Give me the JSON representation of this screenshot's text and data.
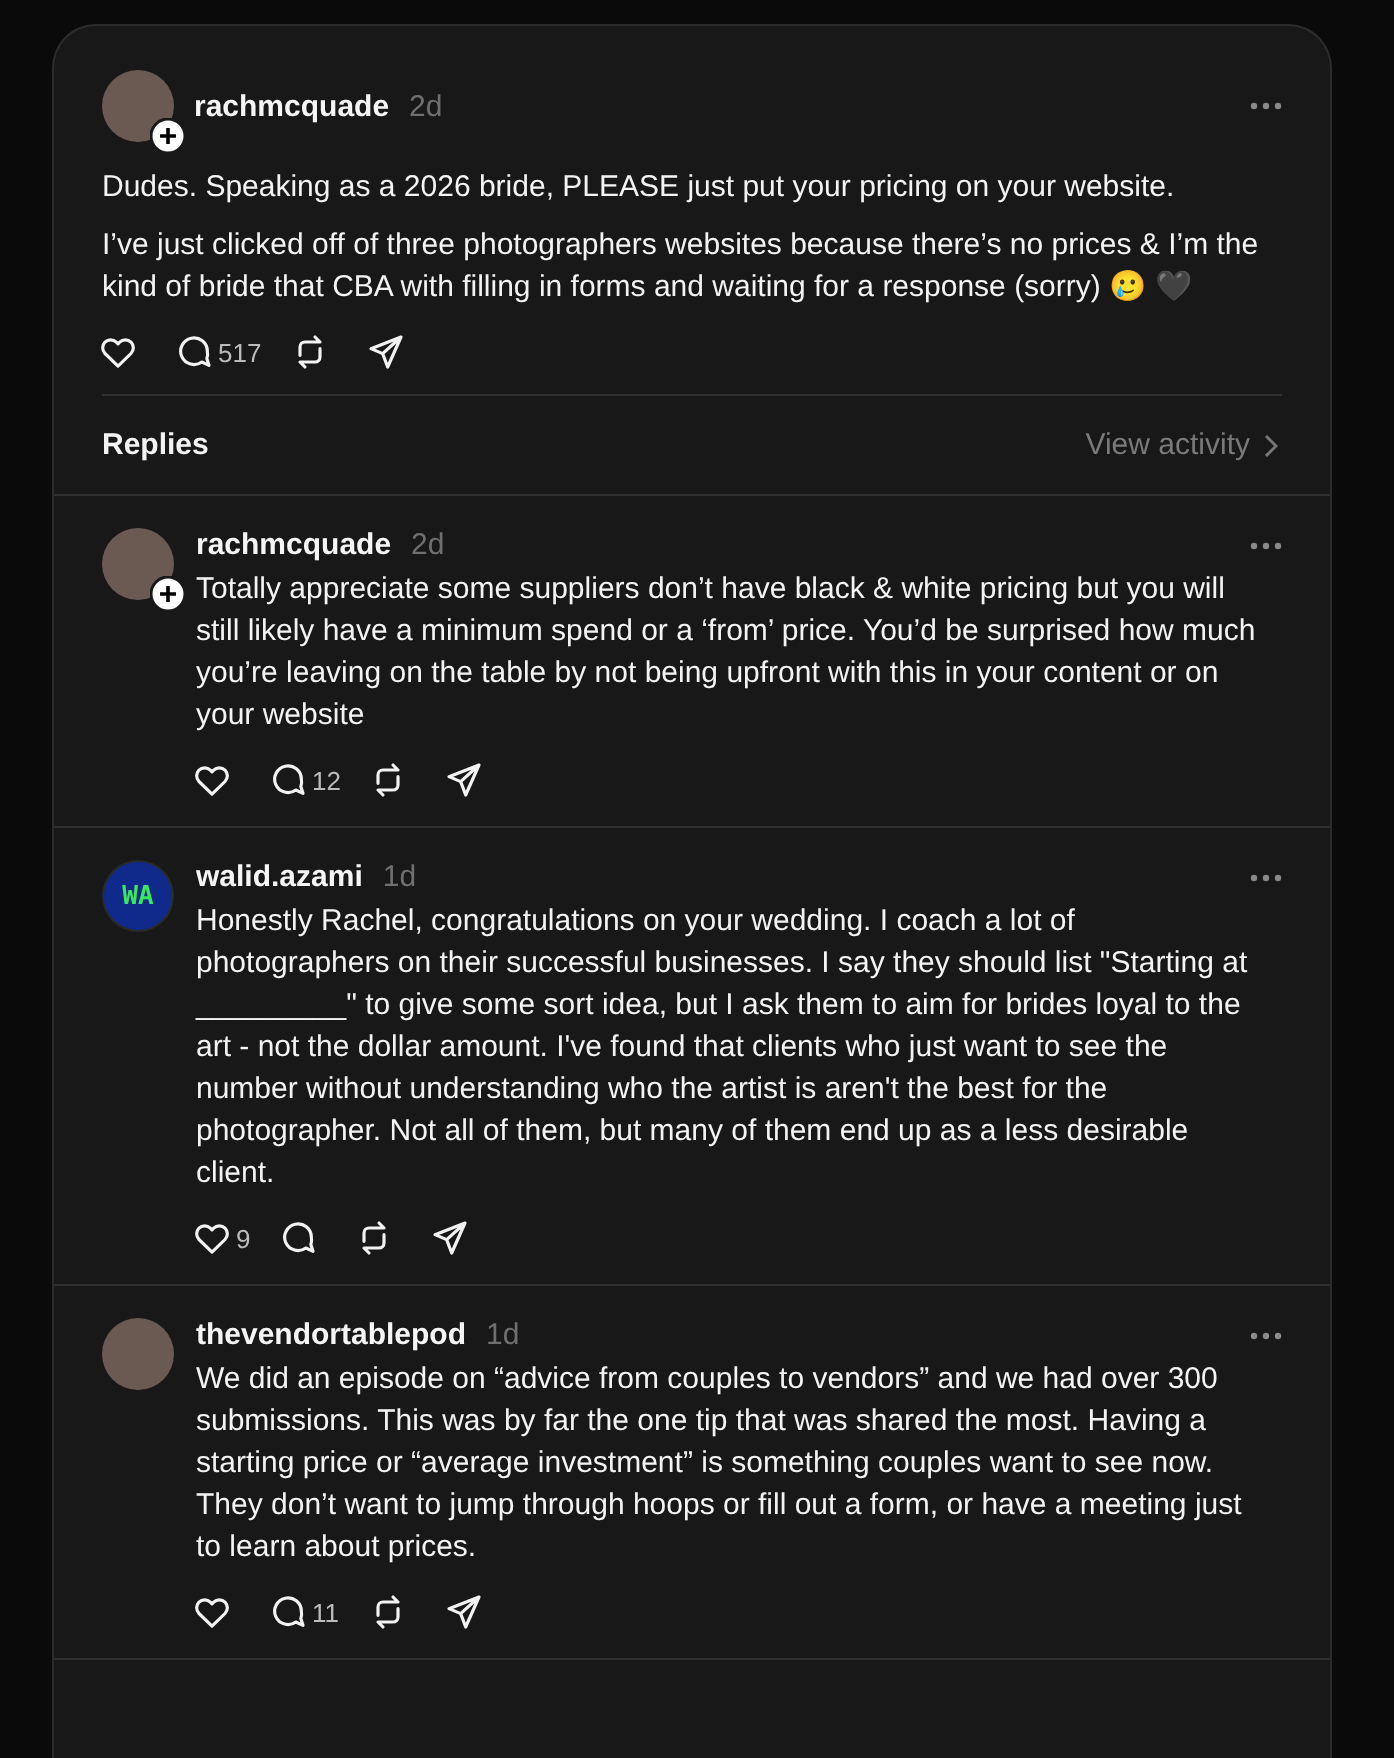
{
  "post": {
    "username": "rachmcquade",
    "time": "2d",
    "follow_badge": true,
    "paragraphs": [
      "Dudes. Speaking as a 2026 bride, PLEASE just put your pricing on your website.",
      "I’ve just clicked off of three photographers websites because there’s no prices & I’m the kind of bride that CBA with filling in forms and waiting for a response (sorry) 🥲 🖤"
    ],
    "reply_count": "517"
  },
  "replies_header": {
    "title": "Replies",
    "link": "View activity"
  },
  "replies": [
    {
      "username": "rachmcquade",
      "time": "2d",
      "kind": "photo",
      "follow_badge": true,
      "text": "Totally appreciate some suppliers don’t have black & white pricing but you will still likely have a minimum spend or a ‘from’ price. You’d be surprised how much you’re leaving on the table by not being upfront with this in your content or on your website",
      "reply_count": "12"
    },
    {
      "username": "walid.azami",
      "time": "1d",
      "kind": "monogram",
      "avatar_text": "WA",
      "follow_badge": false,
      "text": "Honestly Rachel, congratulations on your wedding. I coach a lot of photographers on their successful businesses. I say they should list \"Starting at _________\" to give some sort idea, but I ask them to aim for brides loyal to the art - not the dollar amount. I've found that clients who just want to see the number without understanding who the artist is aren't the best for the photographer. Not all of them, but many of them end up as a less desirable client.",
      "like_count": "9"
    },
    {
      "username": "thevendortablepod",
      "time": "1d",
      "kind": "photo",
      "follow_badge": false,
      "text": "We did an episode on “advice from couples to vendors” and we had over 300 submissions. This was by far the one tip that was shared the most. Having a starting price or “average investment” is something couples want to see now. They don’t want to jump through hoops or fill out a form, or have a meeting just to learn about prices.",
      "reply_count": "11"
    }
  ]
}
